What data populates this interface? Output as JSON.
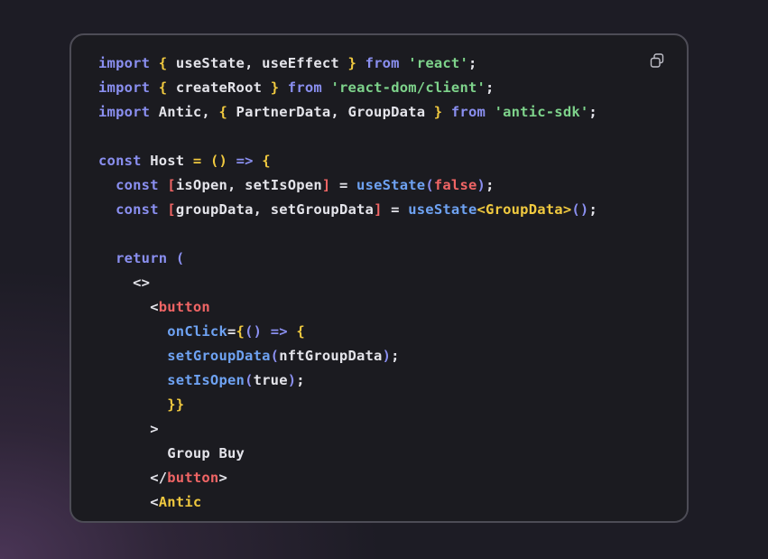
{
  "colors": {
    "background": "#1d1c25",
    "card": "#1b1b20",
    "keyword": "#8a8ff0",
    "bracket": "#f0c93f",
    "identifier": "#e4e4ea",
    "string": "#7ed38b",
    "function": "#6ea2f2",
    "tag": "#f06565"
  },
  "copy_button": {
    "icon": "copy-icon"
  },
  "code_lines": [
    [
      [
        "kw",
        "import"
      ],
      [
        "id",
        " "
      ],
      [
        "br",
        "{"
      ],
      [
        "id",
        " useState, useEffect "
      ],
      [
        "br",
        "}"
      ],
      [
        "id",
        " "
      ],
      [
        "kw",
        "from"
      ],
      [
        "id",
        " "
      ],
      [
        "str",
        "'react'"
      ],
      [
        "id",
        ";"
      ]
    ],
    [
      [
        "kw",
        "import"
      ],
      [
        "id",
        " "
      ],
      [
        "br",
        "{"
      ],
      [
        "id",
        " createRoot "
      ],
      [
        "br",
        "}"
      ],
      [
        "id",
        " "
      ],
      [
        "kw",
        "from"
      ],
      [
        "id",
        " "
      ],
      [
        "str",
        "'react-dom/client'"
      ],
      [
        "id",
        ";"
      ]
    ],
    [
      [
        "kw",
        "import"
      ],
      [
        "id",
        " Antic, "
      ],
      [
        "br",
        "{"
      ],
      [
        "id",
        " PartnerData, GroupData "
      ],
      [
        "br",
        "}"
      ],
      [
        "id",
        " "
      ],
      [
        "kw",
        "from"
      ],
      [
        "id",
        " "
      ],
      [
        "str",
        "'antic-sdk'"
      ],
      [
        "id",
        ";"
      ]
    ],
    [],
    [
      [
        "kw",
        "const"
      ],
      [
        "id",
        " Host "
      ],
      [
        "br",
        "="
      ],
      [
        "id",
        " "
      ],
      [
        "br",
        "()"
      ],
      [
        "id",
        " "
      ],
      [
        "kw",
        "=>"
      ],
      [
        "id",
        " "
      ],
      [
        "br",
        "{"
      ]
    ],
    [
      [
        "id",
        "  "
      ],
      [
        "kw",
        "const"
      ],
      [
        "id",
        " "
      ],
      [
        "red",
        "["
      ],
      [
        "id",
        "isOpen, setIsOpen"
      ],
      [
        "red",
        "]"
      ],
      [
        "id",
        " = "
      ],
      [
        "fn",
        "useState"
      ],
      [
        "kw",
        "("
      ],
      [
        "red",
        "false"
      ],
      [
        "kw",
        ")"
      ],
      [
        "id",
        ";"
      ]
    ],
    [
      [
        "id",
        "  "
      ],
      [
        "kw",
        "const"
      ],
      [
        "id",
        " "
      ],
      [
        "red",
        "["
      ],
      [
        "id",
        "groupData, setGroupData"
      ],
      [
        "red",
        "]"
      ],
      [
        "id",
        " = "
      ],
      [
        "fn",
        "useState"
      ],
      [
        "br",
        "<GroupData>"
      ],
      [
        "kw",
        "()"
      ],
      [
        "id",
        ";"
      ]
    ],
    [],
    [
      [
        "id",
        "  "
      ],
      [
        "kw",
        "return"
      ],
      [
        "id",
        " "
      ],
      [
        "kw",
        "("
      ]
    ],
    [
      [
        "id",
        "    <>"
      ]
    ],
    [
      [
        "id",
        "      <"
      ],
      [
        "red",
        "button"
      ]
    ],
    [
      [
        "id",
        "        "
      ],
      [
        "fn",
        "onClick"
      ],
      [
        "id",
        "="
      ],
      [
        "br",
        "{"
      ],
      [
        "kw",
        "()"
      ],
      [
        "id",
        " "
      ],
      [
        "kw",
        "=>"
      ],
      [
        "id",
        " "
      ],
      [
        "br",
        "{"
      ]
    ],
    [
      [
        "id",
        "        "
      ],
      [
        "fn",
        "setGroupData"
      ],
      [
        "kw",
        "("
      ],
      [
        "id",
        "nftGroupData"
      ],
      [
        "kw",
        ")"
      ],
      [
        "id",
        ";"
      ]
    ],
    [
      [
        "id",
        "        "
      ],
      [
        "fn",
        "setIsOpen"
      ],
      [
        "kw",
        "("
      ],
      [
        "id",
        "true"
      ],
      [
        "kw",
        ")"
      ],
      [
        "id",
        ";"
      ]
    ],
    [
      [
        "id",
        "        "
      ],
      [
        "br",
        "}}"
      ]
    ],
    [
      [
        "id",
        "      >"
      ]
    ],
    [
      [
        "id",
        "        Group Buy"
      ]
    ],
    [
      [
        "id",
        "      </"
      ],
      [
        "red",
        "button"
      ],
      [
        "id",
        ">"
      ]
    ],
    [
      [
        "id",
        "      <"
      ],
      [
        "br",
        "Antic"
      ]
    ]
  ]
}
